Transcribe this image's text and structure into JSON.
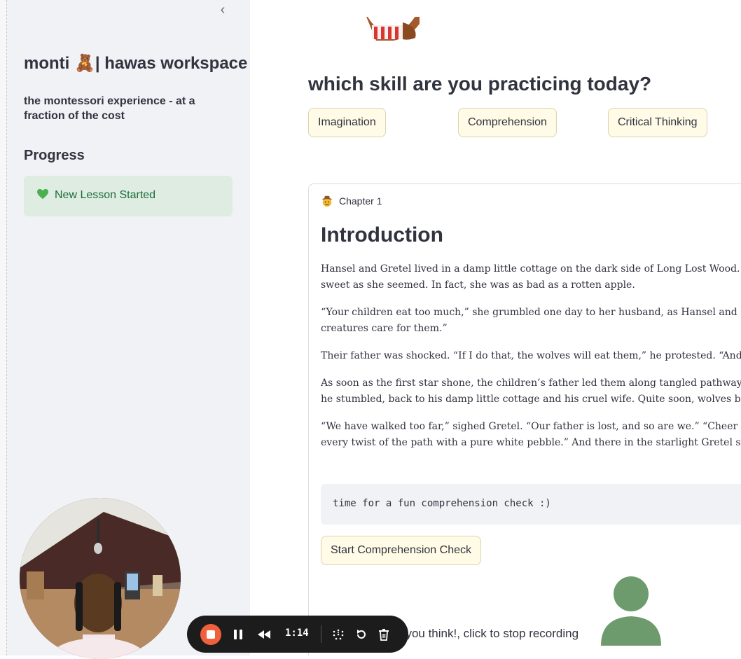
{
  "sidebar": {
    "collapse_icon": "‹",
    "workspace_title": "monti 🧸| hawas workspace",
    "subtitle": "the montessori experience - at a fraction of the cost",
    "progress_heading": "Progress",
    "status_text": "New Lesson Started",
    "status_icon": "green-heart-icon"
  },
  "main": {
    "question": "which skill are you practicing today?",
    "skills": [
      "Imagination",
      "Comprehension",
      "Critical Thinking"
    ],
    "chapter_label": "Chapter 1",
    "section_title": "Introduction",
    "paragraphs": [
      "Hansel and Gretel lived in a damp little cottage on the dark side of Long Lost Wood. Thei",
      "sweet as she seemed. In fact, she was as bad as a rotten apple.",
      "“Your children eat too much,” she grumbled one day to her husband, as Hansel and Gret",
      "creatures care for them.”",
      "Their father was shocked. “If I do that, the wolves will eat them,” he protested. “And if yo",
      "As soon as the first star shone, the children’s father led them along tangled pathways to",
      "he stumbled, back to his damp little cottage and his cruel wife. Quite soon, wolves begai",
      "“We have walked too far,” sighed Gretel. “Our father is lost, and so are we.” “Cheer up, lit",
      "every twist of the path with a pure white pebble.” And there in the starlight Gretel saw a"
    ],
    "code_text": "time for a fun comprehension check :)",
    "start_button": "Start Comprehension Check",
    "recording_text": "t you think!, click to stop recording"
  },
  "recorder": {
    "timer": "1:14",
    "colors": {
      "stop": "#f0603c",
      "bar": "#1c1c1c"
    }
  },
  "colors": {
    "sidebar_bg": "#f0f2f6",
    "status_bg": "#dfece2",
    "button_bg": "#fffbe6",
    "avatar": "#6d9b6d"
  }
}
